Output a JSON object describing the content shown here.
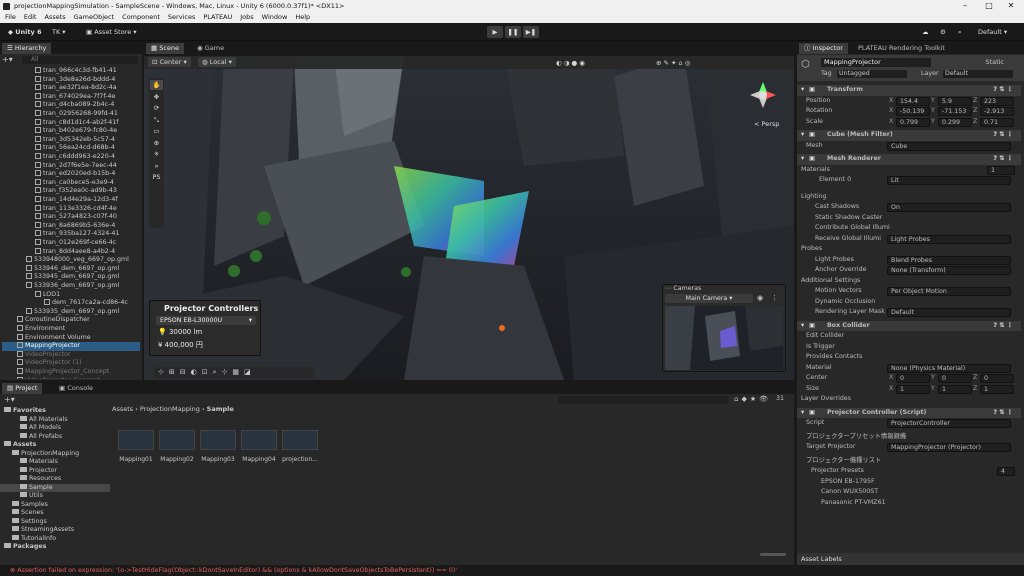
{
  "window": {
    "title": "projectionMappingSimulation - SampleScene - Windows, Mac, Linux - Unity 6 (6000.0.37f1)* <DX11>",
    "minimize": "–",
    "maximize": "□",
    "close": "✕"
  },
  "menu": [
    "File",
    "Edit",
    "Assets",
    "GameObject",
    "Component",
    "Services",
    "PLATEAU",
    "Jobs",
    "Window",
    "Help"
  ],
  "toolbar": {
    "unity": "Unity 6",
    "account": "TK",
    "asset_store": "Asset Store",
    "layout": "Default"
  },
  "hierarchy": {
    "tab": "Hierarchy",
    "search_placeholder": "All",
    "items": [
      {
        "label": "tran_966c4c3d-fb41-41",
        "indent": 3
      },
      {
        "label": "tran_3de8a26d-bddd-4",
        "indent": 3
      },
      {
        "label": "tran_ae32f1ea-8d2c-4a",
        "indent": 3
      },
      {
        "label": "tran_674029ea-7f7f-4e",
        "indent": 3
      },
      {
        "label": "tran_d4cba089-2b4c-4",
        "indent": 3
      },
      {
        "label": "tran_02956268-99fd-41",
        "indent": 3
      },
      {
        "label": "tran_c8d1d1c4-ab2f-41f",
        "indent": 3
      },
      {
        "label": "tran_b402e679-fc80-4e",
        "indent": 3
      },
      {
        "label": "tran_3d5342eb-5c57-4",
        "indent": 3
      },
      {
        "label": "tran_56ea24cd-d68b-4",
        "indent": 3
      },
      {
        "label": "tran_c6ddd963-e220-4",
        "indent": 3
      },
      {
        "label": "tran_2d7f6e5e-7eec-44",
        "indent": 3
      },
      {
        "label": "tran_ed2020ed-b15b-4",
        "indent": 3
      },
      {
        "label": "tran_ca0bece5-e3e9-4",
        "indent": 3
      },
      {
        "label": "tran_f352ea0c-ad9b-43",
        "indent": 3
      },
      {
        "label": "tran_14d4e29a-12d3-4f",
        "indent": 3
      },
      {
        "label": "tran_113e3326-cd4f-4e",
        "indent": 3
      },
      {
        "label": "tran_527a4823-c07f-40",
        "indent": 3
      },
      {
        "label": "tran_8a6869b5-636e-4",
        "indent": 3
      },
      {
        "label": "tran_935ba127-4324-41",
        "indent": 3
      },
      {
        "label": "tran_012e269f-ce66-4c",
        "indent": 3
      },
      {
        "label": "tran_8dd4aee8-a4b2-4",
        "indent": 3
      },
      {
        "label": "533948000_veg_6697_op.gml",
        "indent": 2
      },
      {
        "label": "533946_dem_6697_op.gml",
        "indent": 2
      },
      {
        "label": "533945_dem_6697_op.gml",
        "indent": 2
      },
      {
        "label": "533936_dem_6697_op.gml",
        "indent": 2
      },
      {
        "label": "LOD1",
        "indent": 3
      },
      {
        "label": "dem_7617ca2a-cd86-4c",
        "indent": 4
      },
      {
        "label": "533935_dem_6697_op.gml",
        "indent": 2
      },
      {
        "label": "CoroutineDispatcher",
        "indent": 1
      },
      {
        "label": "Environment",
        "indent": 1
      },
      {
        "label": "Environment Volume",
        "indent": 1
      },
      {
        "label": "MappingProjector",
        "indent": 1,
        "selected": true
      },
      {
        "label": "VideoProjector",
        "indent": 1,
        "dim": true
      },
      {
        "label": "VideoProjector (1)",
        "indent": 1,
        "dim": true
      },
      {
        "label": "MappingProjector_Concept",
        "indent": 1,
        "dim": true
      },
      {
        "label": "VideoProjector_Concept",
        "indent": 1,
        "dim": true
      }
    ]
  },
  "scene": {
    "tabs": [
      "Scene",
      "Game"
    ],
    "pivot": "Center",
    "space": "Local",
    "persp": "< Persp",
    "projector_panel": {
      "title": "Projector Controllers",
      "model": "EPSON EB-L30000U",
      "lumens": "30000 lm",
      "price": "¥ 400,000 円"
    },
    "cameras": {
      "title": "Cameras",
      "selected": "Main Camera"
    },
    "tools": [
      "✋",
      "✥",
      "⟳",
      "⤡",
      "▭",
      "⊕",
      "✳",
      "»",
      "PS"
    ]
  },
  "inspector": {
    "tabs": [
      "Inspector",
      "PLATEAU Rendering Toolkit"
    ],
    "object_name": "MappingProjector",
    "static": "Static",
    "tag_label": "Tag",
    "tag": "Untagged",
    "layer_label": "Layer",
    "layer": "Default",
    "transform": {
      "title": "Transform",
      "position": {
        "label": "Position",
        "x": "154.4",
        "y": "5.9",
        "z": "223"
      },
      "rotation": {
        "label": "Rotation",
        "x": "-50.139",
        "y": "-71.153",
        "z": "-2.913"
      },
      "scale": {
        "label": "Scale",
        "x": "0.799",
        "y": "0.299",
        "z": "0.71"
      }
    },
    "mesh_filter": {
      "title": "Cube (Mesh Filter)",
      "mesh_label": "Mesh",
      "mesh": "Cube"
    },
    "mesh_renderer": {
      "title": "Mesh Renderer",
      "materials": "Materials",
      "count": "1",
      "element": "Element 0",
      "element_value": "Lit",
      "lighting": "Lighting",
      "cast_shadows_label": "Cast Shadows",
      "cast_shadows": "On",
      "static_caster": "Static Shadow Caster",
      "contribute_gi": "Contribute Global Illumi",
      "receive_gi": "Receive Global Illumi",
      "receive_gi_value": "Light Probes",
      "probes": "Probes",
      "light_probes_label": "Light Probes",
      "light_probes": "Blend Probes",
      "anchor_label": "Anchor Override",
      "anchor": "None (Transform)",
      "additional": "Additional Settings",
      "motion_label": "Motion Vectors",
      "motion": "Per Object Motion",
      "dyn_occ": "Dynamic Occlusion",
      "render_layer_label": "Rendering Layer Mask",
      "render_layer": "Default"
    },
    "box_collider": {
      "title": "Box Collider",
      "edit": "Edit Collider",
      "trigger": "Is Trigger",
      "contacts": "Provides Contacts",
      "material_label": "Material",
      "material": "None (Physics Material)",
      "center": {
        "label": "Center",
        "x": "0",
        "y": "0",
        "z": "0"
      },
      "size": {
        "label": "Size",
        "x": "1",
        "y": "1",
        "z": "1"
      },
      "overrides": "Layer Overrides"
    },
    "projector_controller": {
      "title": "Projector Controller (Script)",
      "script_label": "Script",
      "script": "ProjectorController",
      "preset_header": "プロジェクタープリセット情報親機",
      "target_label": "Target Projector",
      "target": "MappingProjector (Projector)",
      "list_header": "プロジェクター機種リスト",
      "presets_label": "Projector Presets",
      "presets_count": "4",
      "presets": [
        "EPSON EB-1795F",
        "Canon WUX500ST",
        "Panasonic PT-VMZ61"
      ]
    },
    "asset_labels": "Asset Labels"
  },
  "project": {
    "tabs": [
      "Project",
      "Console"
    ],
    "breadcrumb": [
      "Assets",
      "ProjectionMapping",
      "Sample"
    ],
    "count": "31",
    "tree": [
      {
        "label": "Favorites",
        "indent": 0,
        "bold": true
      },
      {
        "label": "All Materials",
        "indent": 2
      },
      {
        "label": "All Models",
        "indent": 2
      },
      {
        "label": "All Prefabs",
        "indent": 2
      },
      {
        "label": "Assets",
        "indent": 0,
        "bold": true
      },
      {
        "label": "ProjectionMapping",
        "indent": 1
      },
      {
        "label": "Materials",
        "indent": 2
      },
      {
        "label": "Projector",
        "indent": 2
      },
      {
        "label": "Resources",
        "indent": 2
      },
      {
        "label": "Sample",
        "indent": 2,
        "selected": true
      },
      {
        "label": "Utils",
        "indent": 2
      },
      {
        "label": "Samples",
        "indent": 1
      },
      {
        "label": "Scenes",
        "indent": 1
      },
      {
        "label": "Settings",
        "indent": 1
      },
      {
        "label": "StreamingAssets",
        "indent": 1
      },
      {
        "label": "TutorialInfo",
        "indent": 1
      },
      {
        "label": "Packages",
        "indent": 0,
        "bold": true
      }
    ],
    "assets": [
      "Mapping01",
      "Mapping02",
      "Mapping03",
      "Mapping04",
      "projection..."
    ]
  },
  "status": "Assertion failed on expression: '(o->TestHideFlag(Object::kDontSaveInEditor) && (options & kAllowDontSaveObjectsToBePersistent)) == 0)'"
}
